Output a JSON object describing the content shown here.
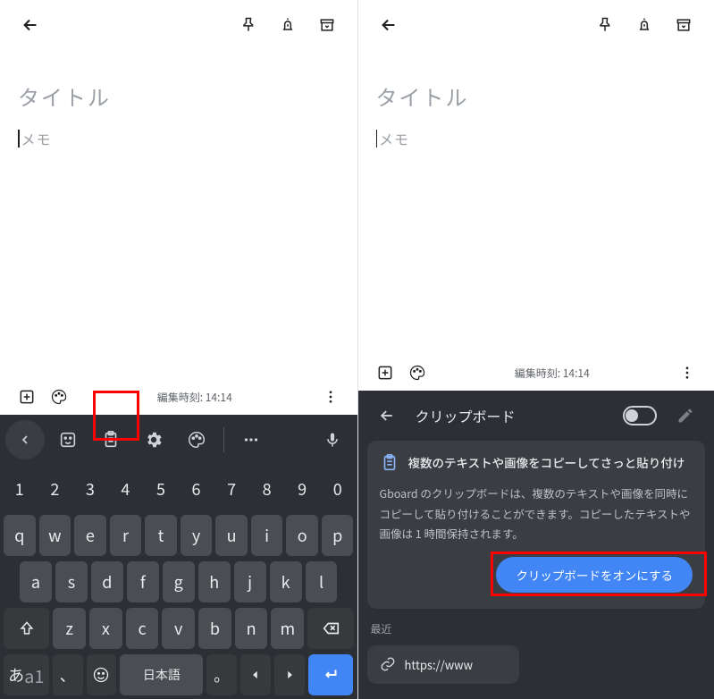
{
  "left": {
    "note": {
      "title_placeholder": "タイトル",
      "memo_placeholder": "メモ"
    },
    "bottom": {
      "edit_time": "編集時刻: 14:14"
    },
    "keyboard": {
      "row1": [
        "1",
        "2",
        "3",
        "4",
        "5",
        "6",
        "7",
        "8",
        "9",
        "0"
      ],
      "row2": [
        "q",
        "w",
        "e",
        "r",
        "t",
        "y",
        "u",
        "i",
        "o",
        "p"
      ],
      "row3": [
        "a",
        "s",
        "d",
        "f",
        "g",
        "h",
        "j",
        "k",
        "l"
      ],
      "row4_mid": [
        "z",
        "x",
        "c",
        "v",
        "b",
        "n",
        "m"
      ],
      "lang_main": "あ",
      "lang_sub": "a1",
      "space": "日本語",
      "comma": "、",
      "period": "。"
    }
  },
  "right": {
    "note": {
      "title_placeholder": "タイトル",
      "memo_placeholder": "メモ"
    },
    "bottom": {
      "edit_time": "編集時刻: 14:14"
    },
    "clipboard": {
      "header": "クリップボード",
      "card_title": "複数のテキストや画像をコピーしてさっと貼り付け",
      "card_body": "Gboard のクリップボードは、複数のテキストや画像を同時にコピーして貼り付けることができます。コピーしたテキストや画像は 1 時間保持されます。",
      "cta": "クリップボードをオンにする",
      "recent_label": "最近",
      "recent_item": "https://www"
    }
  }
}
